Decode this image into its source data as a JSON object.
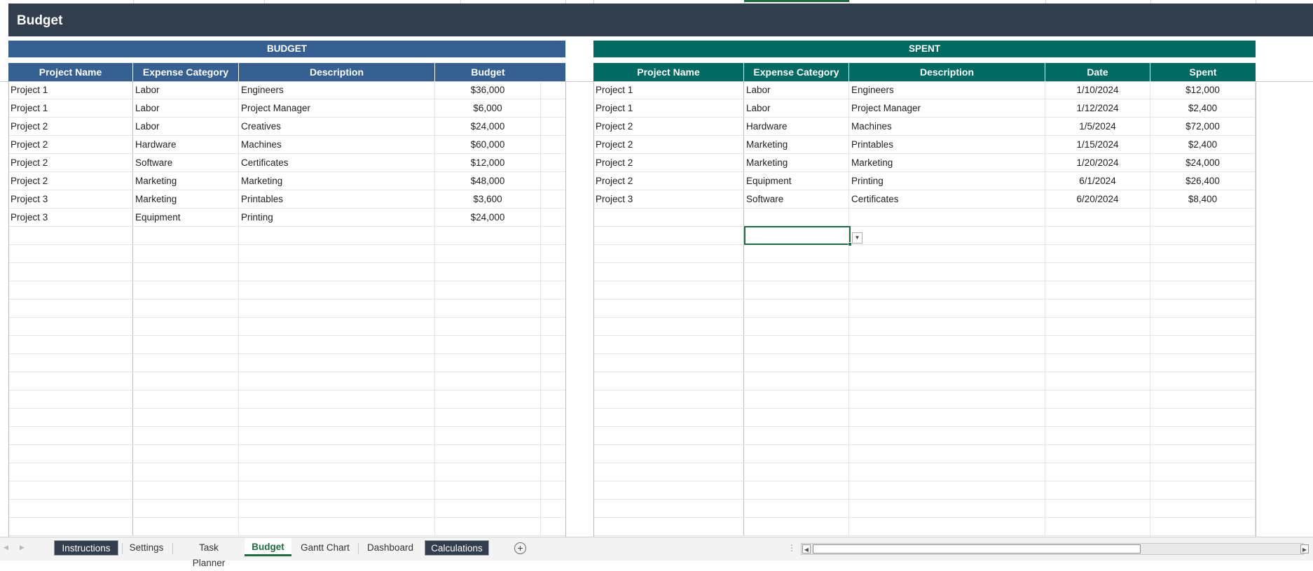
{
  "header": {
    "title": "Budget"
  },
  "budget_table": {
    "section_title": "BUDGET",
    "header_color": "#376092",
    "columns": [
      "Project Name",
      "Expense Category",
      "Description",
      "Budget"
    ],
    "rows": [
      [
        "Project 1",
        "Labor",
        "Engineers",
        "$36,000"
      ],
      [
        "Project 1",
        "Labor",
        "Project Manager",
        "$6,000"
      ],
      [
        "Project 2",
        "Labor",
        "Creatives",
        "$24,000"
      ],
      [
        "Project 2",
        "Hardware",
        "Machines",
        "$60,000"
      ],
      [
        "Project 2",
        "Software",
        "Certificates",
        "$12,000"
      ],
      [
        "Project 2",
        "Marketing",
        "Marketing",
        "$48,000"
      ],
      [
        "Project 3",
        "Marketing",
        "Printables",
        "$3,600"
      ],
      [
        "Project 3",
        "Equipment",
        "Printing",
        "$24,000"
      ]
    ]
  },
  "spent_table": {
    "section_title": "SPENT",
    "header_color": "#016a62",
    "columns": [
      "Project Name",
      "Expense Category",
      "Description",
      "Date",
      "Spent"
    ],
    "rows": [
      [
        "Project 1",
        "Labor",
        "Engineers",
        "1/10/2024",
        "$12,000"
      ],
      [
        "Project 1",
        "Labor",
        "Project Manager",
        "1/12/2024",
        "$2,400"
      ],
      [
        "Project 2",
        "Hardware",
        "Machines",
        "1/5/2024",
        "$72,000"
      ],
      [
        "Project 2",
        "Marketing",
        "Printables",
        "1/15/2024",
        "$2,400"
      ],
      [
        "Project 2",
        "Marketing",
        "Marketing",
        "1/20/2024",
        "$24,000"
      ],
      [
        "Project 2",
        "Equipment",
        "Printing",
        "6/1/2024",
        "$26,400"
      ],
      [
        "Project 3",
        "Software",
        "Certificates",
        "6/20/2024",
        "$8,400"
      ]
    ]
  },
  "sheet_tabs": {
    "tabs": [
      {
        "label": "Instructions",
        "style": "dark"
      },
      {
        "label": "Settings",
        "style": "plain"
      },
      {
        "label": "Task Planner",
        "style": "plain"
      },
      {
        "label": "Budget",
        "style": "active"
      },
      {
        "label": "Gantt Chart",
        "style": "plain"
      },
      {
        "label": "Dashboard",
        "style": "plain"
      },
      {
        "label": "Calculations",
        "style": "dark"
      }
    ],
    "add_icon": "plus-circle-icon"
  },
  "colors": {
    "title_bar": "#323d4d",
    "accent_green": "#1d6b40"
  }
}
